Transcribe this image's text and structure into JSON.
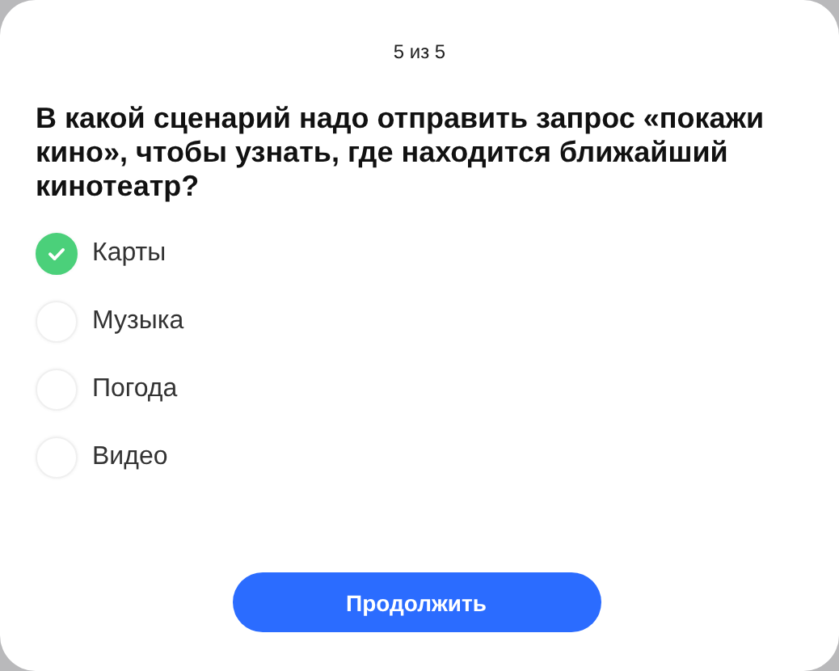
{
  "progress": "5 из 5",
  "question": "В какой сценарий надо отправить запрос «покажи кино», чтобы узнать, где находится ближайший кинотеатр?",
  "options": [
    {
      "label": "Карты",
      "selected": true
    },
    {
      "label": "Музыка",
      "selected": false
    },
    {
      "label": "Погода",
      "selected": false
    },
    {
      "label": "Видео",
      "selected": false
    }
  ],
  "button": "Продолжить"
}
